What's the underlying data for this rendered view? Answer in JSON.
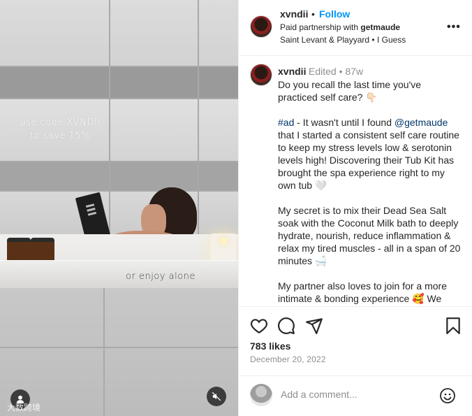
{
  "media": {
    "overlay_code_line1": "use code XVNDII",
    "overlay_code_line2": "to save 15%",
    "overlay_alone": "or enjoy alone",
    "watermark": "大数跨境"
  },
  "header": {
    "username": "xvndii",
    "separator": "•",
    "follow_label": "Follow",
    "partnership_prefix": "Paid partnership with ",
    "partner_name": "getmaude",
    "audio": "Saint Levant & Playyard • I Guess",
    "more_label": "•••"
  },
  "caption": {
    "username": "xvndii",
    "meta": "Edited • 87w",
    "para1": "Do you recall the last time you've practiced self care? 👇🏻",
    "hashtag": "#ad",
    "para2_a": " - It wasn't until I found ",
    "mention": "@getmaude",
    "para2_b": " that I started a consistent self care routine to keep my stress levels low & serotonin levels high! Discovering their Tub Kit has brought the spa experience right to my own tub 🤍",
    "para3": "My secret is to mix their Dead Sea Salt soak with the Coconut Milk bath to deeply hydrate, nourish, reduce inflammation & relax my tired muscles - all in a span of 20 minutes 🛁",
    "para4": "My partner also loves to join for a more intimate & bonding experience 🥰 We"
  },
  "actions": {
    "likes": "783 likes",
    "date": "December 20, 2022"
  },
  "comment": {
    "placeholder": "Add a comment..."
  },
  "colors": {
    "follow_blue": "#0095f6",
    "link_blue": "#00376b",
    "muted_gray": "#8e8e8e"
  }
}
